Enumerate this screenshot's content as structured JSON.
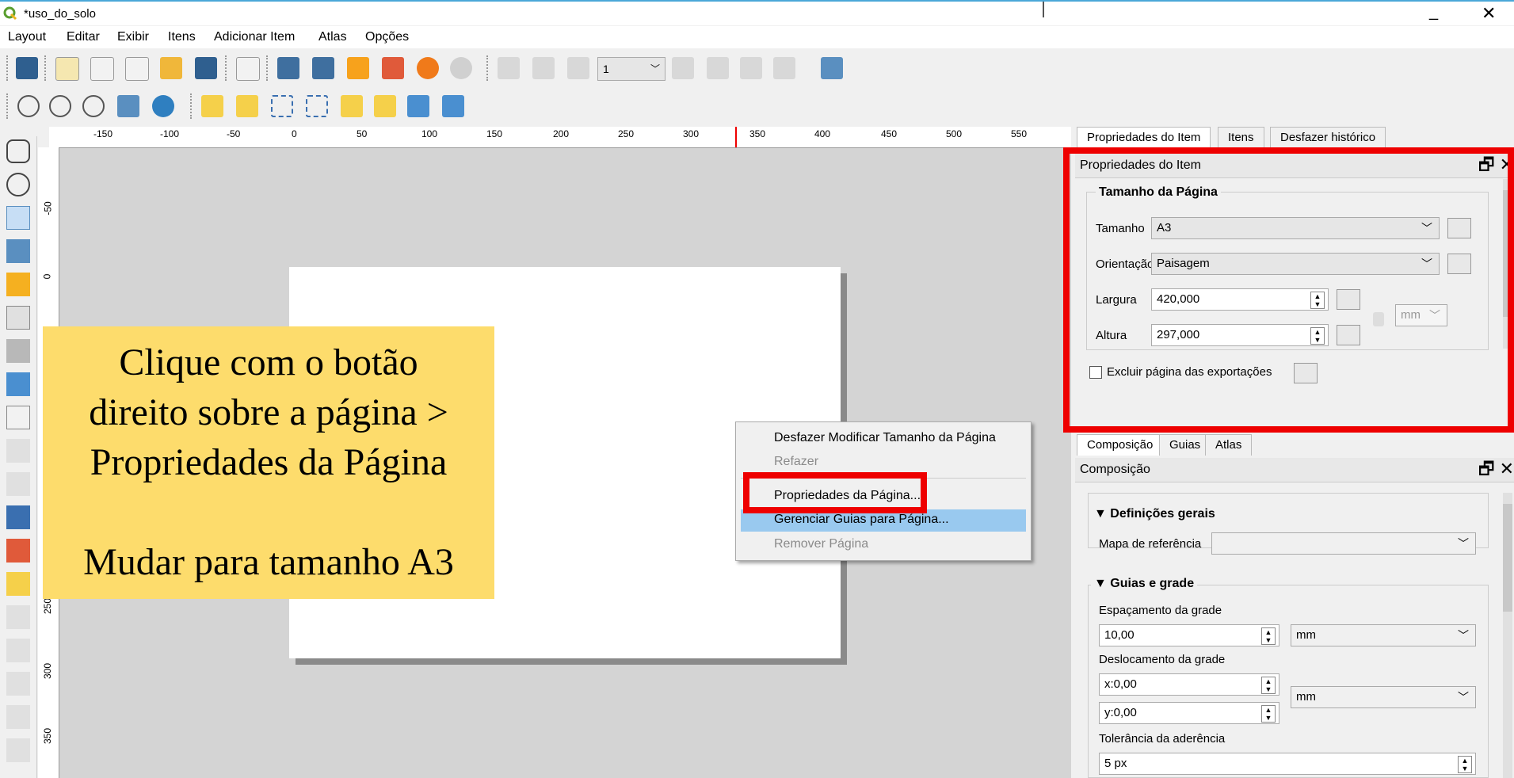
{
  "window": {
    "title": "*uso_do_solo",
    "minimize": "_",
    "close": "✕"
  },
  "menubar": [
    "Layout",
    "Editar",
    "Exibir",
    "Itens",
    "Adicionar Item",
    "Atlas",
    "Opções"
  ],
  "toolbar": {
    "page_number": "1"
  },
  "ruler_top": [
    "-150",
    "-100",
    "-50",
    "0",
    "50",
    "100",
    "150",
    "200",
    "250",
    "300",
    "350",
    "400",
    "450",
    "500",
    "550"
  ],
  "ruler_left": [
    "-50",
    "0",
    "250",
    "300",
    "350"
  ],
  "callout": {
    "line1": "Clique com o botão",
    "line2": "direito sobre a página >",
    "line3": "Propriedades da Página",
    "line4": "Mudar para tamanho A3"
  },
  "context_menu": {
    "undo": "Desfazer Modificar Tamanho da Página",
    "redo": "Refazer",
    "page_props": "Propriedades da Página...",
    "manage_guides": "Gerenciar Guias para Página...",
    "remove_page": "Remover Página"
  },
  "dock": {
    "top_tabs": [
      "Propriedades do Item",
      "Itens",
      "Desfazer histórico"
    ],
    "item_props": {
      "title": "Propriedades do Item",
      "group": "Tamanho da Página",
      "size_label": "Tamanho",
      "size_value": "A3",
      "orientation_label": "Orientação",
      "orientation_value": "Paisagem",
      "width_label": "Largura",
      "width_value": "420,000",
      "height_label": "Altura",
      "height_value": "297,000",
      "unit": "mm",
      "exclude_label": "Excluir página das exportações"
    },
    "bottom_tabs": [
      "Composição",
      "Guias",
      "Atlas"
    ],
    "composition": {
      "title": "Composição",
      "general_group": "Definições gerais",
      "ref_map_label": "Mapa de referência",
      "ref_map_value": "",
      "guides_group": "Guias e grade",
      "grid_spacing_label": "Espaçamento da grade",
      "grid_spacing_value": "10,00",
      "grid_spacing_unit": "mm",
      "grid_offset_label": "Deslocamento da grade",
      "offset_x": "x:0,00",
      "offset_y": "y:0,00",
      "offset_unit": "mm",
      "snap_label": "Tolerância da aderência",
      "snap_value": "5 px"
    }
  },
  "colors": {
    "highlight_red": "#e00000",
    "callout_yellow": "#fddc6c",
    "menu_highlight": "#99c9ef"
  }
}
